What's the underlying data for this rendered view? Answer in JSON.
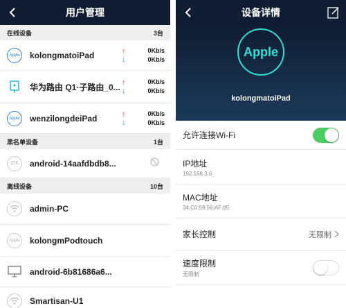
{
  "left": {
    "nav": {
      "title": "用户管理",
      "back_icon": "chevron-left-icon"
    },
    "online": {
      "label": "在线设备",
      "count": "3台",
      "devices": [
        {
          "name": "kolongmatoiPad",
          "icon_text": "Apple",
          "up": "0Kb/s",
          "down": "0Kb/s"
        },
        {
          "name": "华为路由 Q1·子路由_0...",
          "icon_text": "",
          "up": "0Kb/s",
          "down": "0Kb/s"
        },
        {
          "name": "wenzilongdeiPad",
          "icon_text": "Apple",
          "up": "0Kb/s",
          "down": "0Kb/s"
        }
      ]
    },
    "blacklist": {
      "label": "黑名单设备",
      "count": "1台",
      "devices": [
        {
          "name": "android-14aafdbdb8...",
          "icon_text": "ZTE"
        }
      ]
    },
    "offline": {
      "label": "离线设备",
      "count": "10台",
      "devices": [
        {
          "name": "admin-PC"
        },
        {
          "name": "kolongmPodtouch",
          "icon_text": "Apple"
        },
        {
          "name": "android-6b81686a6..."
        },
        {
          "name": "Smartisan-U1"
        }
      ]
    },
    "arrows": {
      "up": "↑",
      "down": "↓"
    }
  },
  "right": {
    "nav": {
      "title": "设备详情",
      "back_icon": "chevron-left-icon",
      "edit_icon": "edit-icon"
    },
    "hero": {
      "logo_text": "Apple",
      "device_name": "kolongmatoiPad"
    },
    "wifi": {
      "label": "允许连接Wi-Fi",
      "enabled": true
    },
    "ip": {
      "label": "IP地址",
      "value": "192.168.3.6"
    },
    "mac": {
      "label": "MAC地址",
      "value": "34:C0:59:56:AF:85"
    },
    "parental": {
      "label": "家长控制",
      "value": "无限制"
    },
    "speed_limit": {
      "label": "速度限制",
      "value": "无限制",
      "enabled": false
    }
  },
  "colors": {
    "navbar": "#101c31",
    "accent": "#2fe0d6",
    "toggle_on": "#4ccd62",
    "up_arrow": "#e04a5e",
    "down_arrow": "#3a8fd8"
  }
}
